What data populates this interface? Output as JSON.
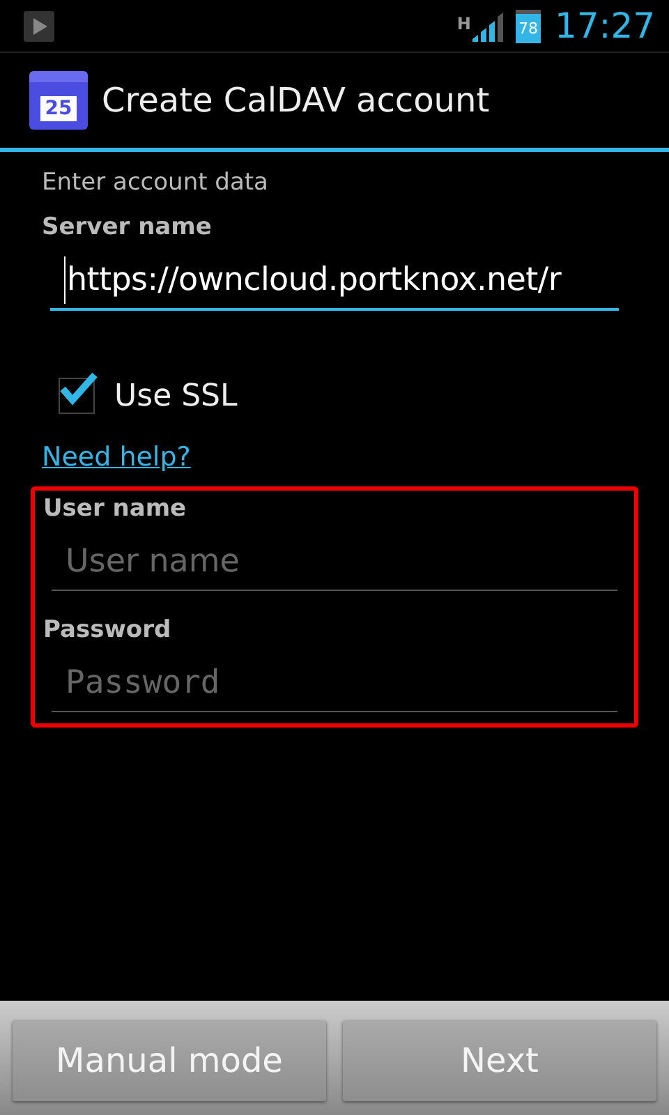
{
  "status_bar": {
    "battery": "78",
    "time": "17:27",
    "network": "H"
  },
  "action_bar": {
    "title": "Create CalDAV account",
    "icon_day": "25"
  },
  "section_title": "Enter account data",
  "server": {
    "label": "Server name",
    "value": "https://owncloud.portknox.net/r",
    "focused": true
  },
  "ssl": {
    "label": "Use SSL",
    "checked": true
  },
  "help_link": "Need help?",
  "credentials": {
    "highlighted": true,
    "fields": [
      {
        "label": "User name",
        "placeholder": "User name",
        "kind": "text"
      },
      {
        "label": "Password",
        "placeholder": "Password",
        "kind": "password"
      }
    ]
  },
  "buttons": [
    "Manual mode",
    "Next"
  ]
}
